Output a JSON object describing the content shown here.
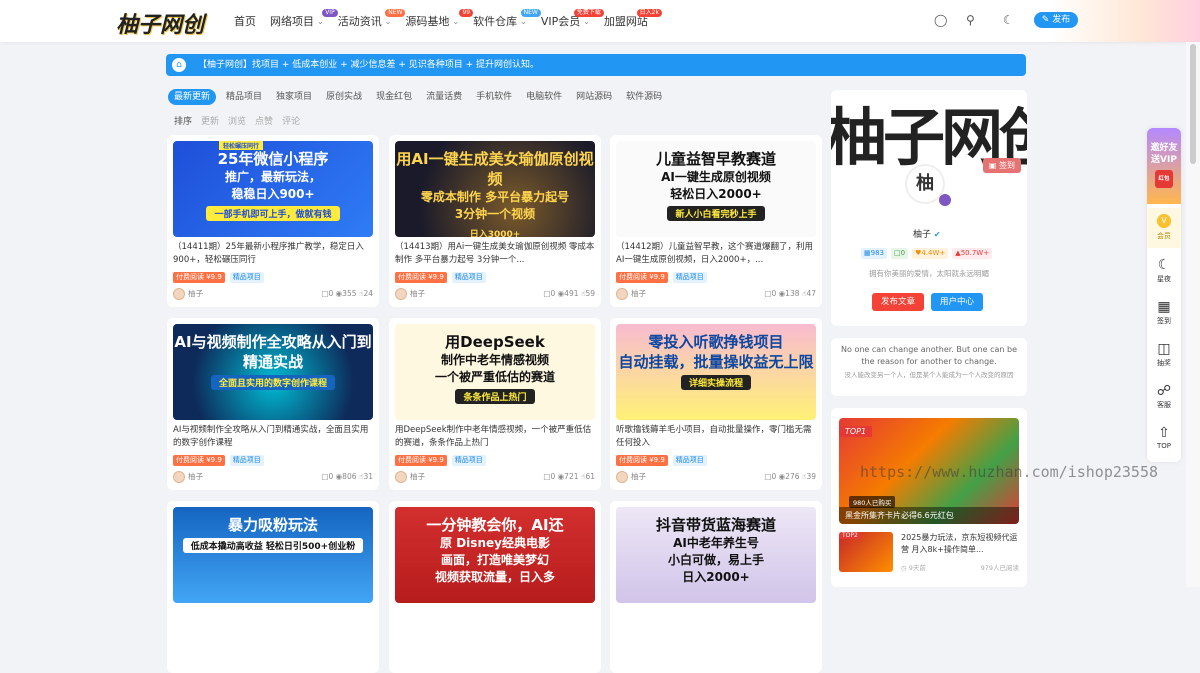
{
  "header": {
    "logo": "柚子网创",
    "nav": [
      {
        "label": "首页",
        "badge": "",
        "chevron": false
      },
      {
        "label": "网络项目",
        "badge": "VIP",
        "badge_color": "#7e57c2",
        "chevron": true
      },
      {
        "label": "活动资讯",
        "badge": "NEW",
        "badge_color": "#ff7043",
        "chevron": true
      },
      {
        "label": "源码基地",
        "badge": "99",
        "badge_color": "#f44336",
        "chevron": true
      },
      {
        "label": "软件仓库",
        "badge": "NEW",
        "badge_color": "#42a5f5",
        "chevron": true
      },
      {
        "label": "VIP会员",
        "badge": "免费下载",
        "badge_color": "#f44336",
        "chevron": true
      },
      {
        "label": "加盟网站",
        "badge": "日入2k",
        "badge_color": "#f44336",
        "chevron": false
      }
    ],
    "publish_label": "发布"
  },
  "notice": "【柚子网创】找项目 + 低成本创业 + 减少信息差 + 见识各种项目 + 提升网创认知。",
  "tabs": [
    "最新更新",
    "精品项目",
    "独家项目",
    "原创实战",
    "现金红包",
    "流量话费",
    "手机软件",
    "电脑软件",
    "网站源码",
    "软件源码"
  ],
  "sort": [
    "排序",
    "更新",
    "浏览",
    "点赞",
    "评论"
  ],
  "cards": [
    {
      "thumb_lines": [
        "25年微信小程序",
        "推广，最新玩法，",
        "稳稳日入900+"
      ],
      "thumb_sub": "一部手机即可上手，做就有钱",
      "thumb_badge": "轻松碾压同行",
      "thumb_style": "blue",
      "title": "（14411期）25年最新小程序推广教学，稳定日入900+，轻松碾压同行",
      "tag1": "付费阅读 ¥9.9",
      "tag2": "精品项目",
      "author": "柚子",
      "comments": "0",
      "views": "355",
      "likes": "24"
    },
    {
      "thumb_lines": [
        "用AI一键生成美女瑜伽原创视频",
        "零成本制作 多平台暴力起号",
        "3分钟一个视频"
      ],
      "thumb_sub": "日入3000+",
      "thumb_badge": "",
      "thumb_style": "dark",
      "title": "（14413期）用Ai一键生成美女瑜伽原创视频 零成本制作 多平台暴力起号 3分钟一个...",
      "tag1": "付费阅读 ¥9.9",
      "tag2": "精品项目",
      "author": "柚子",
      "comments": "0",
      "views": "491",
      "likes": "59"
    },
    {
      "thumb_lines": [
        "儿童益智早教赛道",
        "AI一键生成原创视频",
        "轻松日入2000+"
      ],
      "thumb_sub": "新人小白看完秒上手",
      "thumb_badge": "",
      "thumb_style": "light",
      "title": "（14412期）儿童益智早教，这个赛道爆翻了，利用AI一键生成原创视频，日入2000+，...",
      "tag1": "付费阅读 ¥9.9",
      "tag2": "精品项目",
      "author": "柚子",
      "comments": "0",
      "views": "138",
      "likes": "47"
    },
    {
      "thumb_lines": [
        "AI与视频制作全攻略从入门到精通实战"
      ],
      "thumb_sub": "全面且实用的数字创作课程",
      "thumb_badge": "",
      "thumb_style": "tech",
      "title": "AI与视频制作全攻略从入门到精通实战，全面且实用的数字创作课程",
      "tag1": "付费阅读 ¥9.9",
      "tag2": "精品项目",
      "author": "柚子",
      "comments": "0",
      "views": "806",
      "likes": "31"
    },
    {
      "thumb_lines": [
        "用DeepSeek",
        "制作中老年情感视频",
        "一个被严重低估的赛道"
      ],
      "thumb_sub": "条条作品上热门",
      "thumb_badge": "",
      "thumb_style": "yellow",
      "title": "用DeepSeek制作中老年情感视频，一个被严重低估的赛道，条条作品上热门",
      "tag1": "付费阅读 ¥9.9",
      "tag2": "精品项目",
      "author": "柚子",
      "comments": "0",
      "views": "721",
      "likes": "61"
    },
    {
      "thumb_lines": [
        "零投入听歌挣钱项目",
        "自动挂载，批量操收益无上限"
      ],
      "thumb_sub": "详细实操流程",
      "thumb_badge": "",
      "thumb_style": "pink",
      "title": "听歌撸钱薅羊毛小项目，自动批量操作，零门槛无需任何投入",
      "tag1": "付费阅读 ¥9.9",
      "tag2": "精品项目",
      "author": "柚子",
      "comments": "0",
      "views": "276",
      "likes": "39"
    },
    {
      "thumb_lines": [
        "暴力吸粉玩法"
      ],
      "thumb_sub": "低成本撬动高收益 轻松日引500+创业粉",
      "thumb_badge": "",
      "thumb_style": "blue2",
      "title": "",
      "tag1": "",
      "tag2": "",
      "author": "",
      "comments": "",
      "views": "",
      "likes": ""
    },
    {
      "thumb_lines": [
        "一分钟教会你，AI还",
        "原 Disney经典电影",
        "画面，打造唯美梦幻",
        "视频获取流量，日入多"
      ],
      "thumb_sub": "",
      "thumb_badge": "",
      "thumb_style": "red",
      "title": "",
      "tag1": "",
      "tag2": "",
      "author": "",
      "comments": "",
      "views": "",
      "likes": ""
    },
    {
      "thumb_lines": [
        "抖音带货蓝海赛道",
        "AI中老年养生号",
        "小白可做，易上手",
        "日入2000+"
      ],
      "thumb_sub": "",
      "thumb_badge": "",
      "thumb_style": "purple",
      "title": "",
      "tag1": "",
      "tag2": "",
      "author": "",
      "comments": "",
      "views": "",
      "likes": ""
    }
  ],
  "profile": {
    "banner_text": "柚子网创",
    "sign_label": "签到",
    "avatar_char": "柚",
    "name": "柚子",
    "stats": [
      "983",
      "0",
      "4.4W+",
      "50.7W+"
    ],
    "bio": "拥有你美丽的爱情，太阳就永远明媚",
    "btn_post": "发布文章",
    "btn_user": "用户中心"
  },
  "quote": {
    "en": "No one can change another. But one can be the reason for another to change.",
    "zh": "没人能改变另一个人，但是某个人能成为一个人改变的原因"
  },
  "side_post": {
    "top_label": "TOP1",
    "img_badge": "980人已购买",
    "caption": "黑金所集齐卡片必得6.6元红包",
    "item_rank": "TOP2",
    "item_title": "2025暴力玩法，京东短视频代运营 月入8k+操作简单...",
    "item_time": "9天前",
    "item_views": "979人已阅读"
  },
  "watermark": "https://www.huzhan.com/ishop23558",
  "float_bar": {
    "invite": "邀好友送VIP",
    "hb": "红包",
    "vip": "会员",
    "items": [
      "星夜",
      "签到",
      "抽奖",
      "客服",
      "TOP"
    ]
  }
}
